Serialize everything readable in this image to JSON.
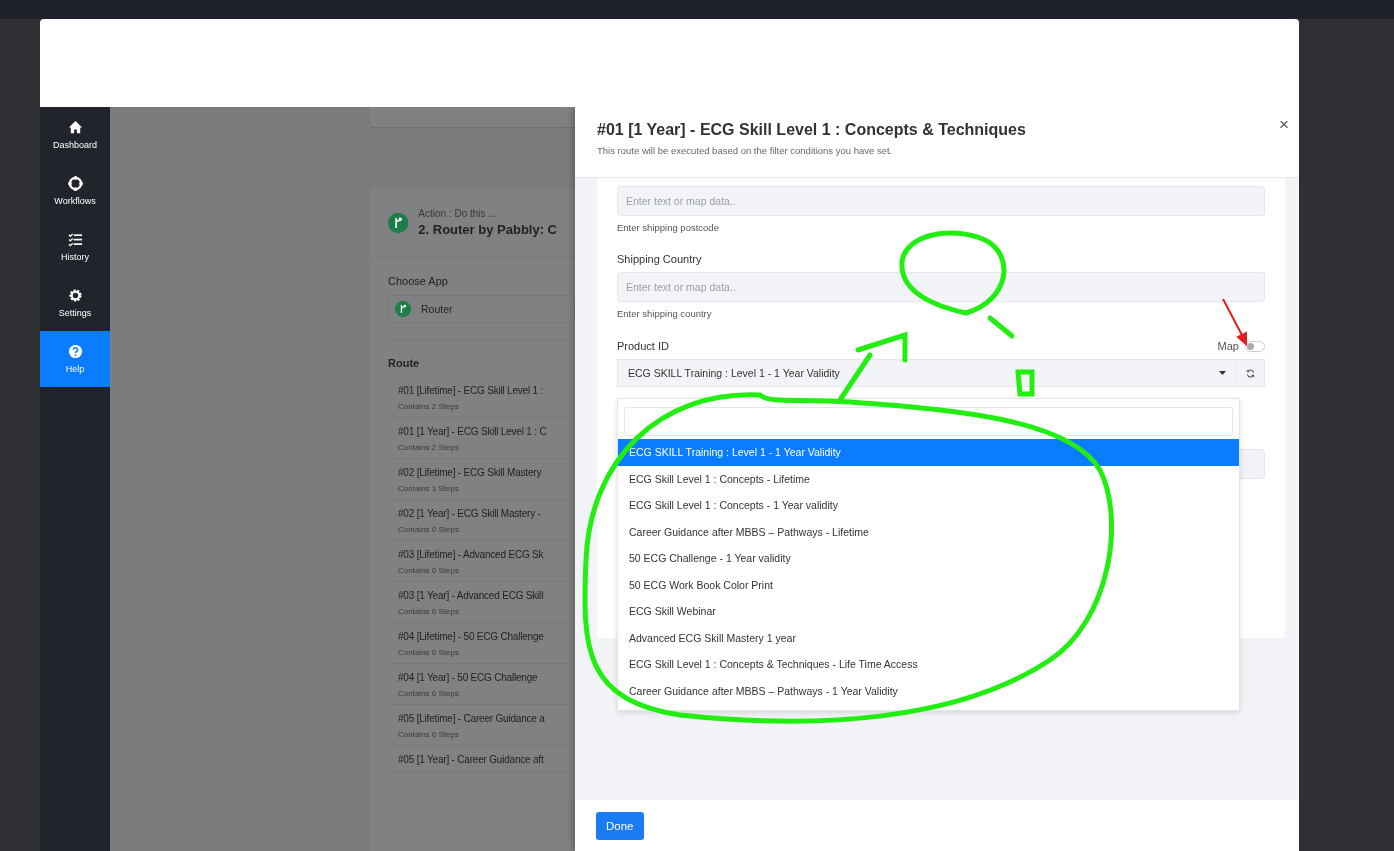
{
  "sidebar": {
    "items": [
      {
        "kind": "home",
        "label": "Dashboard",
        "selected": false
      },
      {
        "kind": "workflow",
        "label": "Workflows",
        "selected": false
      },
      {
        "kind": "history",
        "label": "History",
        "selected": false
      },
      {
        "kind": "settings",
        "label": "Settings",
        "selected": false
      },
      {
        "kind": "help",
        "label": "Help",
        "selected": true
      }
    ]
  },
  "background_step": {
    "action_label": "Action : Do this ...",
    "title": "2. Router by Pabbly: C",
    "choose_app_label": "Choose App",
    "app": "Router",
    "route_label": "Route",
    "routes": [
      {
        "title": "#01 [Lifetime] - ECG Skill Level 1 :",
        "steps": "Contains 2 Steps"
      },
      {
        "title": "#01 [1 Year] - ECG Skill Level 1 : C",
        "steps": "Contains 2 Steps"
      },
      {
        "title": "#02 [Lifetime] - ECG Skill Mastery",
        "steps": "Contains 1 Steps"
      },
      {
        "title": "#02 [1 Year] - ECG Skill Mastery -",
        "steps": "Contains 0 Steps"
      },
      {
        "title": "#03 [Lifetime] - Advanced ECG Sk",
        "steps": "Contains 0 Steps"
      },
      {
        "title": "#03 [1 Year] - Advanced ECG Skill",
        "steps": "Contains 0 Steps"
      },
      {
        "title": "#04 [Lifetime] - 50 ECG Challenge",
        "steps": "Contains 0 Steps"
      },
      {
        "title": "#04 [1 Year] - 50 ECG Challenge",
        "steps": "Contains 0 Steps"
      },
      {
        "title": "#05 [Lifetime] - Career Guidance a",
        "steps": "Contains 0 Steps"
      },
      {
        "title": "#05 [1 Year] - Career Guidance aft"
      }
    ]
  },
  "modal": {
    "title": "#01 [1 Year] - ECG Skill Level 1 : Concepts & Techniques",
    "subtitle": "This route will be executed based on the filter conditions you have set.",
    "close": "×",
    "fields": [
      {
        "placeholder": "Enter text or map data..",
        "hint": "Enter shipping postcode"
      },
      {
        "label": "Shipping Country",
        "placeholder": "Enter text or map data..",
        "hint": "Enter shipping country"
      }
    ],
    "product": {
      "label": "Product ID",
      "map_label": "Map",
      "map_on": false,
      "value": "ECG SKILL Training : Level 1 - 1 Year Validity",
      "dropdown_expanded": true,
      "options": [
        {
          "label": "ECG SKILL Training : Level 1 - 1 Year Validity",
          "selected": true
        },
        {
          "label": "ECG Skill Level 1 : Concepts - Lifetime",
          "selected": false
        },
        {
          "label": "ECG Skill Level 1 : Concepts - 1 Year validity",
          "selected": false
        },
        {
          "label": "Career Guidance after MBBS – Pathways - Lifetime",
          "selected": false
        },
        {
          "label": "50 ECG Challenge - 1 Year validity",
          "selected": false
        },
        {
          "label": "50 ECG Work Book Color Print",
          "selected": false
        },
        {
          "label": "ECG Skill Webinar",
          "selected": false
        },
        {
          "label": "Advanced ECG Skill Mastery 1 year",
          "selected": false
        },
        {
          "label": "ECG Skill Level 1 : Concepts & Techniques - Life Time Access",
          "selected": false
        },
        {
          "label": "Career Guidance after MBBS – Pathways - 1 Year Validity",
          "selected": false
        }
      ]
    },
    "done_button": "Done"
  }
}
